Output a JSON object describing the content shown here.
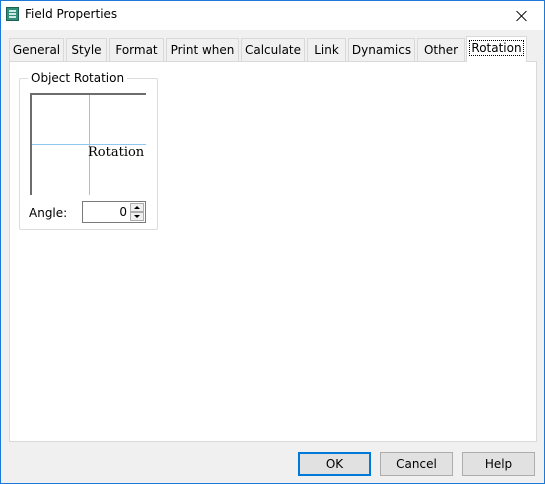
{
  "window": {
    "title": "Field Properties"
  },
  "tabs": [
    {
      "label": "General",
      "active": false
    },
    {
      "label": "Style",
      "active": false
    },
    {
      "label": "Format",
      "active": false
    },
    {
      "label": "Print when",
      "active": false
    },
    {
      "label": "Calculate",
      "active": false
    },
    {
      "label": "Link",
      "active": false
    },
    {
      "label": "Dynamics",
      "active": false
    },
    {
      "label": "Other",
      "active": false
    },
    {
      "label": "Rotation",
      "active": true
    }
  ],
  "rotation": {
    "group_label": "Object Rotation",
    "preview_text": "Rotation",
    "angle_label": "Angle:",
    "angle_value": "0"
  },
  "buttons": {
    "ok": "OK",
    "cancel": "Cancel",
    "help": "Help"
  },
  "colors": {
    "accent": "#0078d7",
    "guide_line": "#8fc8ef"
  }
}
